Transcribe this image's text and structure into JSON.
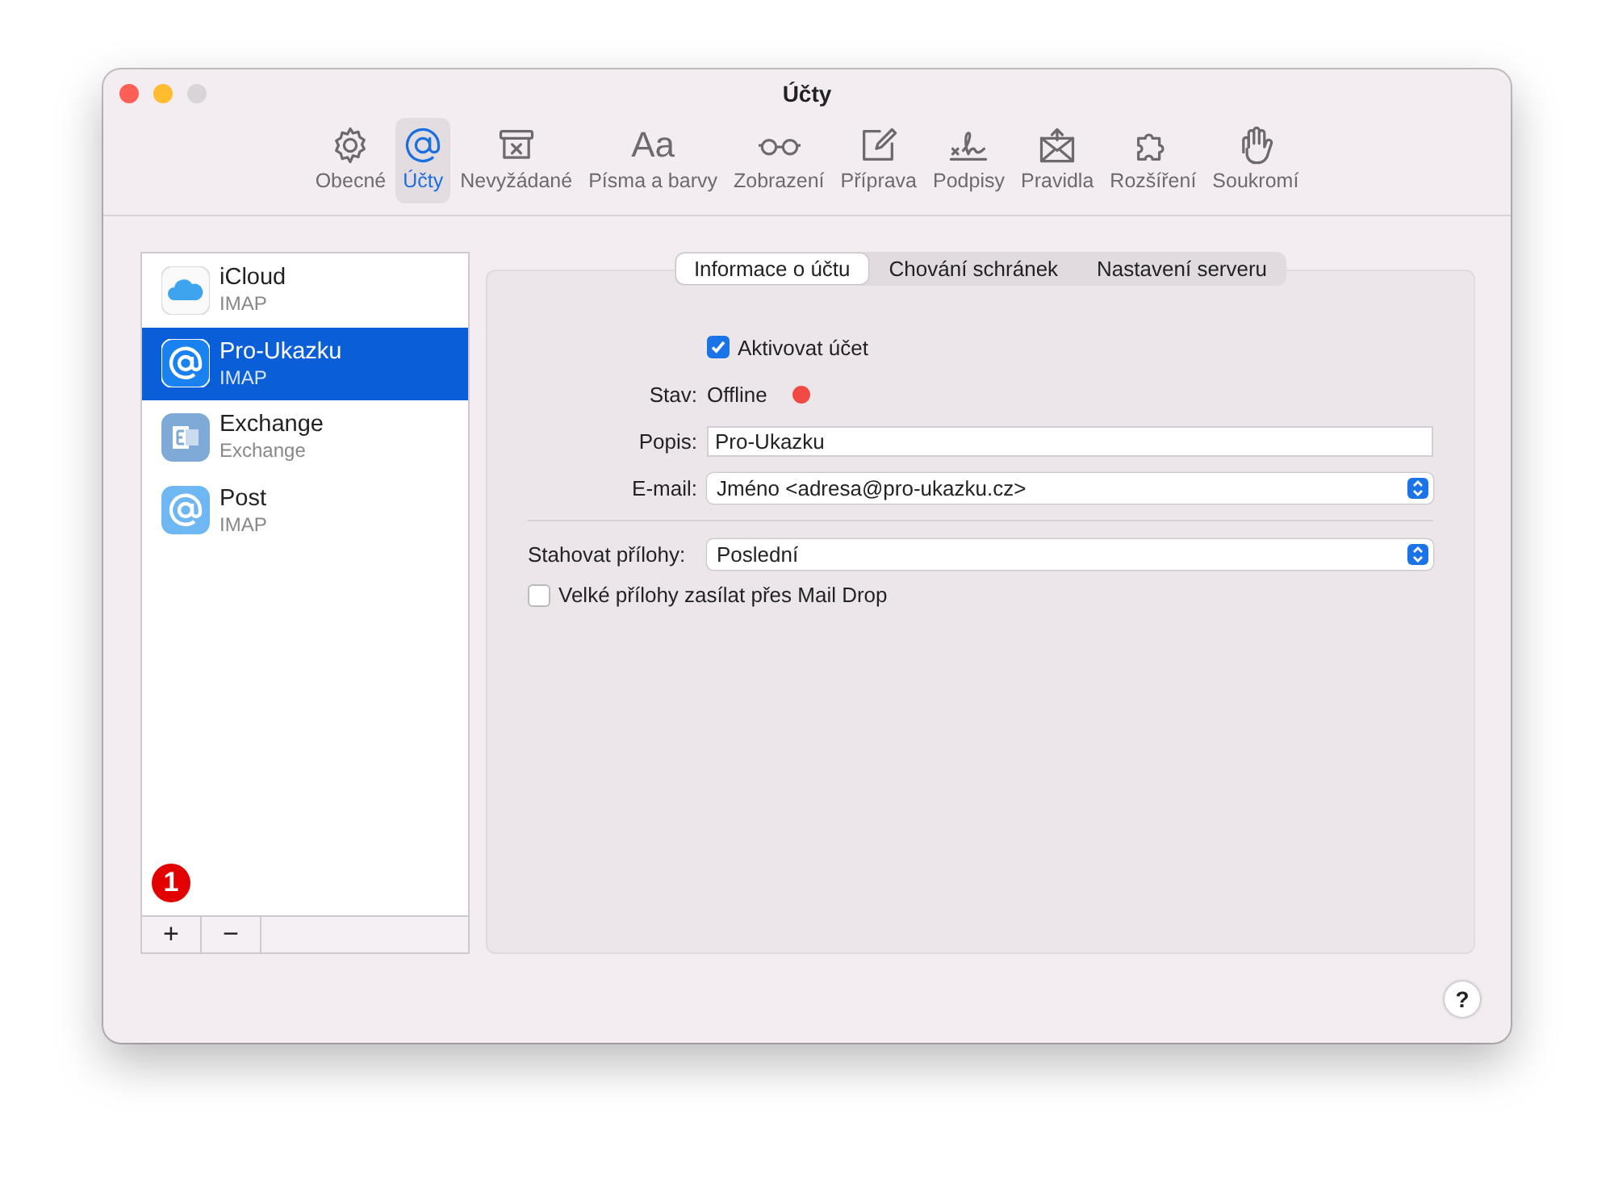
{
  "window": {
    "title": "Účty"
  },
  "toolbar": [
    {
      "label": "Obecné",
      "selected": false
    },
    {
      "label": "Účty",
      "selected": true
    },
    {
      "label": "Nevyžádané",
      "selected": false
    },
    {
      "label": "Písma a barvy",
      "selected": false,
      "glyph": "Aa"
    },
    {
      "label": "Zobrazení",
      "selected": false
    },
    {
      "label": "Příprava",
      "selected": false
    },
    {
      "label": "Podpisy",
      "selected": false
    },
    {
      "label": "Pravidla",
      "selected": false
    },
    {
      "label": "Rozšíření",
      "selected": false
    },
    {
      "label": "Soukromí",
      "selected": false
    }
  ],
  "accounts": [
    {
      "name": "iCloud",
      "type": "IMAP",
      "selected": false
    },
    {
      "name": "Pro-Ukazku",
      "type": "IMAP",
      "selected": true
    },
    {
      "name": "Exchange",
      "type": "Exchange",
      "selected": false
    },
    {
      "name": "Post",
      "type": "IMAP",
      "selected": false
    }
  ],
  "annotation_badge": "1",
  "list_buttons": [
    "+",
    "−"
  ],
  "tabs": [
    {
      "label": "Informace o účtu",
      "selected": true
    },
    {
      "label": "Chování schránek",
      "selected": false
    },
    {
      "label": "Nastavení serveru",
      "selected": false
    }
  ],
  "activate": {
    "label": "Aktivovat účet",
    "checked": true
  },
  "status": {
    "label": "Stav:",
    "value": "Offline",
    "color": "#f04a44"
  },
  "description": {
    "label": "Popis:",
    "value": "Pro-Ukazku"
  },
  "email": {
    "label": "E-mail:",
    "value": "Jméno <adresa@pro-ukazku.cz>"
  },
  "download": {
    "label": "Stahovat přílohy:",
    "value": "Poslední"
  },
  "mail_drop": {
    "label": "Velké přílohy zasílat přes Mail Drop",
    "checked": false
  },
  "help_button": "?"
}
